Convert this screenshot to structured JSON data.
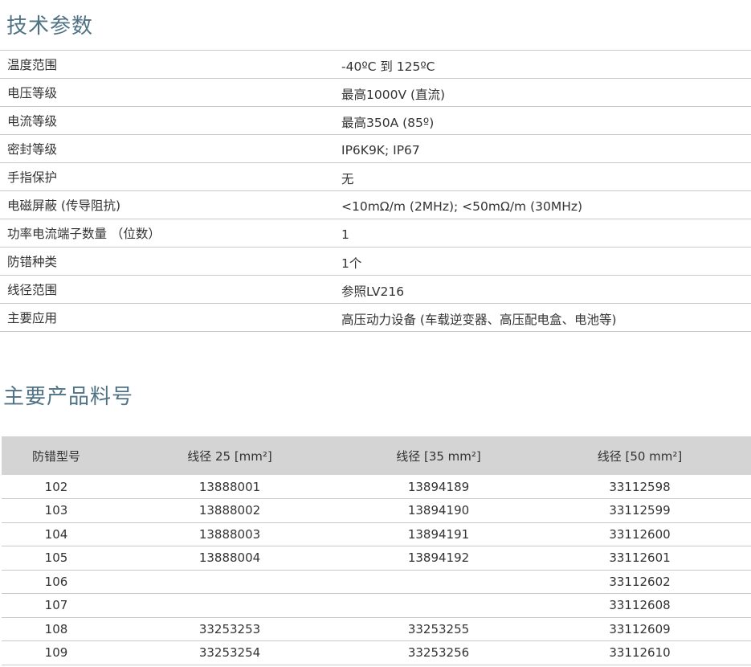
{
  "sections": {
    "tech_title": "技术参数",
    "parts_title": "主要产品料号"
  },
  "specs": [
    {
      "label": "温度范围",
      "value": "-40ºC 到 125ºC"
    },
    {
      "label": "电压等级",
      "value": "最高1000V (直流)"
    },
    {
      "label": "电流等级",
      "value": "最高350A (85º)"
    },
    {
      "label": "密封等级",
      "value": "IP6K9K; IP67"
    },
    {
      "label": "手指保护",
      "value": "无"
    },
    {
      "label": "电磁屏蔽 (传导阻抗)",
      "value": "<10mΩ/m (2MHz); <50mΩ/m (30MHz)"
    },
    {
      "label": "功率电流端子数量 （位数）",
      "value": "1"
    },
    {
      "label": "防错种类",
      "value": "1个"
    },
    {
      "label": "线径范围",
      "value": "参照LV216"
    },
    {
      "label": "主要应用",
      "value": "高压动力设备 (车载逆变器、高压配电盒、电池等)"
    }
  ],
  "parts_table": {
    "headers": [
      "防错型号",
      "线径 25 [mm²]",
      "线径 [35 mm²]",
      "线径 [50 mm²]"
    ],
    "rows": [
      [
        "102",
        "13888001",
        "13894189",
        "33112598"
      ],
      [
        "103",
        "13888002",
        "13894190",
        "33112599"
      ],
      [
        "104",
        "13888003",
        "13894191",
        "33112600"
      ],
      [
        "105",
        "13888004",
        "13894192",
        "33112601"
      ],
      [
        "106",
        "",
        "",
        "33112602"
      ],
      [
        "107",
        "",
        "",
        "33112608"
      ],
      [
        "108",
        "33253253",
        "33253255",
        "33112609"
      ],
      [
        "109",
        "33253254",
        "33253256",
        "33112610"
      ]
    ]
  },
  "colors": {
    "title": "#4f7285",
    "header_bg": "#d4d4d4",
    "rule": "#c9c9c9"
  }
}
